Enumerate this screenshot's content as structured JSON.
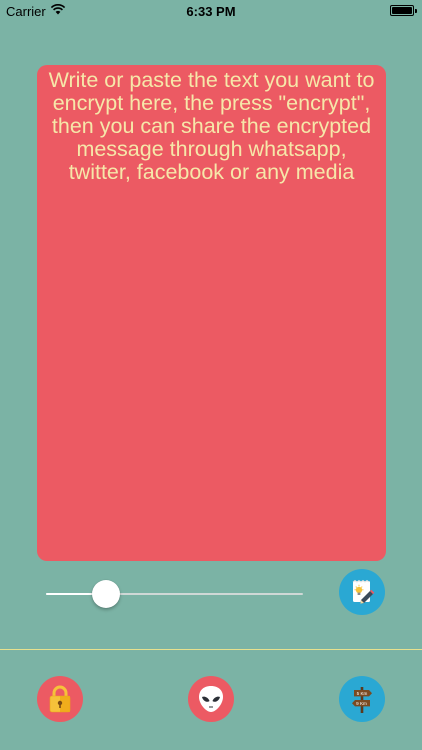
{
  "status_bar": {
    "carrier": "Carrier",
    "time": "6:33 PM"
  },
  "editor": {
    "placeholder_text": "Write or paste the text you want to encrypt here, the press \"encrypt\", then you can share the encrypted message through whatsapp, twitter, facebook or any media",
    "background_color": "#ec5a63",
    "text_color": "#f6e7a9"
  },
  "slider": {
    "value": 0.2
  },
  "buttons": {
    "paste_icon": "note-pencil-icon",
    "encrypt_icon": "lock-icon",
    "decrypt_icon": "alien-icon",
    "distance_icon": "signpost-icon",
    "signpost_top": "5 Km",
    "signpost_bottom": "9 Km"
  },
  "colors": {
    "background": "#7bb3a5",
    "accent_red": "#ec5a63",
    "accent_blue": "#2aa8d3",
    "divider": "#e7e18e"
  }
}
